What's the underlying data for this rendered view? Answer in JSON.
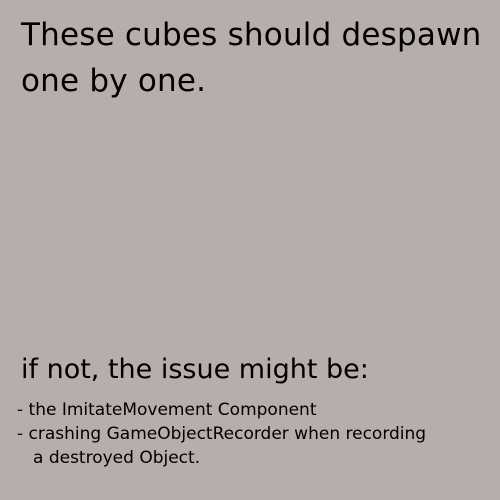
{
  "scene": {
    "background_color": "#b7aeac"
  },
  "headline": {
    "line1": "These cubes should despawn",
    "line2": "one by one."
  },
  "issues": {
    "heading": "if not, the issue might be:",
    "items": [
      {
        "text": "- the ImitateMovement Component",
        "continuation": ""
      },
      {
        "text": "- crashing GameObjectRecorder when recording",
        "continuation": "a destroyed Object."
      }
    ]
  }
}
